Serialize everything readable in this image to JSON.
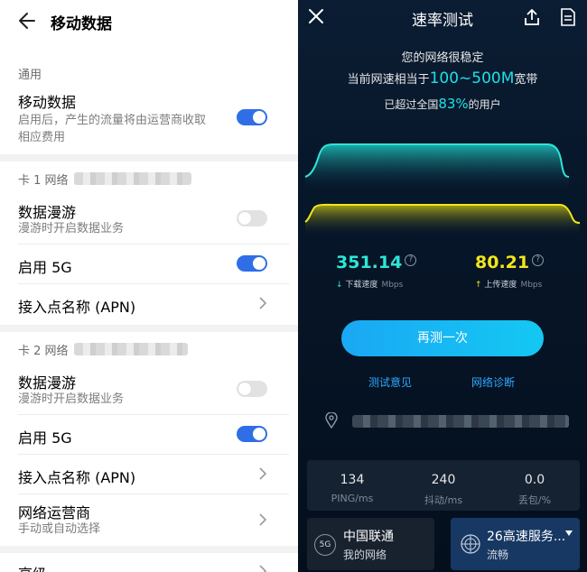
{
  "left": {
    "title": "移动数据",
    "general_header": "通用",
    "mobile_data": {
      "title": "移动数据",
      "subtitle_line1": "启用后，产生的流量将由运营商收取",
      "subtitle_line2": "相应费用",
      "enabled": true
    },
    "sim1": {
      "header": "卡 1 网络",
      "roaming": {
        "title": "数据漫游",
        "subtitle": "漫游时开启数据业务",
        "enabled": false
      },
      "enable5g": {
        "title": "启用 5G",
        "enabled": true
      },
      "apn": {
        "title": "接入点名称 (APN)"
      }
    },
    "sim2": {
      "header": "卡 2 网络",
      "roaming": {
        "title": "数据漫游",
        "subtitle": "漫游时开启数据业务",
        "enabled": false
      },
      "enable5g": {
        "title": "启用 5G",
        "enabled": true
      },
      "apn": {
        "title": "接入点名称 (APN)"
      },
      "operator": {
        "title": "网络运营商",
        "subtitle": "手动或自动选择"
      }
    },
    "advanced": {
      "title": "高级"
    }
  },
  "right": {
    "title": "速率测试",
    "status": "您的网络很稳定",
    "equiv_prefix": "当前网速相当于",
    "equiv_value": "100~500M",
    "equiv_suffix": "宽带",
    "beat_prefix": "已超过全国",
    "beat_value": "83%",
    "beat_suffix": "的用户",
    "download": {
      "value": "351.14",
      "label": "下载速度",
      "unit": "Mbps",
      "color": "#2ee6d6"
    },
    "upload": {
      "value": "80.21",
      "label": "上传速度",
      "unit": "Mbps",
      "color": "#f2e61a"
    },
    "retest_label": "再测一次",
    "feedback_label": "测试意见",
    "diagnose_label": "网络诊断",
    "stats": [
      {
        "value": "134",
        "label": "PING/ms"
      },
      {
        "value": "240",
        "label": "抖动/ms"
      },
      {
        "value": "0.0",
        "label": "丢包/%"
      }
    ],
    "carrier": {
      "badge": "5G",
      "name": "中国联通",
      "sub": "我的网络"
    },
    "server": {
      "name": "26高速服务...",
      "sub": "流畅"
    }
  }
}
